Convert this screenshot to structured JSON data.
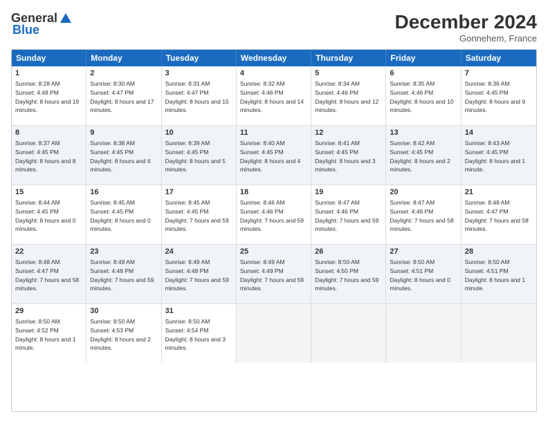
{
  "logo": {
    "general": "General",
    "blue": "Blue"
  },
  "header": {
    "month_year": "December 2024",
    "location": "Gonnehem, France"
  },
  "days_of_week": [
    "Sunday",
    "Monday",
    "Tuesday",
    "Wednesday",
    "Thursday",
    "Friday",
    "Saturday"
  ],
  "weeks": [
    [
      {
        "day": "1",
        "text": "Sunrise: 8:28 AM\nSunset: 4:48 PM\nDaylight: 8 hours and 19 minutes.",
        "shaded": false
      },
      {
        "day": "2",
        "text": "Sunrise: 8:30 AM\nSunset: 4:47 PM\nDaylight: 8 hours and 17 minutes.",
        "shaded": false
      },
      {
        "day": "3",
        "text": "Sunrise: 8:31 AM\nSunset: 4:47 PM\nDaylight: 8 hours and 15 minutes.",
        "shaded": false
      },
      {
        "day": "4",
        "text": "Sunrise: 8:32 AM\nSunset: 4:46 PM\nDaylight: 8 hours and 14 minutes.",
        "shaded": false
      },
      {
        "day": "5",
        "text": "Sunrise: 8:34 AM\nSunset: 4:46 PM\nDaylight: 8 hours and 12 minutes.",
        "shaded": false
      },
      {
        "day": "6",
        "text": "Sunrise: 8:35 AM\nSunset: 4:46 PM\nDaylight: 8 hours and 10 minutes.",
        "shaded": false
      },
      {
        "day": "7",
        "text": "Sunrise: 8:36 AM\nSunset: 4:45 PM\nDaylight: 8 hours and 9 minutes.",
        "shaded": false
      }
    ],
    [
      {
        "day": "8",
        "text": "Sunrise: 8:37 AM\nSunset: 4:45 PM\nDaylight: 8 hours and 8 minutes.",
        "shaded": true
      },
      {
        "day": "9",
        "text": "Sunrise: 8:38 AM\nSunset: 4:45 PM\nDaylight: 8 hours and 6 minutes.",
        "shaded": true
      },
      {
        "day": "10",
        "text": "Sunrise: 8:39 AM\nSunset: 4:45 PM\nDaylight: 8 hours and 5 minutes.",
        "shaded": true
      },
      {
        "day": "11",
        "text": "Sunrise: 8:40 AM\nSunset: 4:45 PM\nDaylight: 8 hours and 4 minutes.",
        "shaded": true
      },
      {
        "day": "12",
        "text": "Sunrise: 8:41 AM\nSunset: 4:45 PM\nDaylight: 8 hours and 3 minutes.",
        "shaded": true
      },
      {
        "day": "13",
        "text": "Sunrise: 8:42 AM\nSunset: 4:45 PM\nDaylight: 8 hours and 2 minutes.",
        "shaded": true
      },
      {
        "day": "14",
        "text": "Sunrise: 8:43 AM\nSunset: 4:45 PM\nDaylight: 8 hours and 1 minute.",
        "shaded": true
      }
    ],
    [
      {
        "day": "15",
        "text": "Sunrise: 8:44 AM\nSunset: 4:45 PM\nDaylight: 8 hours and 0 minutes.",
        "shaded": false
      },
      {
        "day": "16",
        "text": "Sunrise: 8:45 AM\nSunset: 4:45 PM\nDaylight: 8 hours and 0 minutes.",
        "shaded": false
      },
      {
        "day": "17",
        "text": "Sunrise: 8:45 AM\nSunset: 4:45 PM\nDaylight: 7 hours and 59 minutes.",
        "shaded": false
      },
      {
        "day": "18",
        "text": "Sunrise: 8:46 AM\nSunset: 4:46 PM\nDaylight: 7 hours and 59 minutes.",
        "shaded": false
      },
      {
        "day": "19",
        "text": "Sunrise: 8:47 AM\nSunset: 4:46 PM\nDaylight: 7 hours and 59 minutes.",
        "shaded": false
      },
      {
        "day": "20",
        "text": "Sunrise: 8:47 AM\nSunset: 4:46 PM\nDaylight: 7 hours and 58 minutes.",
        "shaded": false
      },
      {
        "day": "21",
        "text": "Sunrise: 8:48 AM\nSunset: 4:47 PM\nDaylight: 7 hours and 58 minutes.",
        "shaded": false
      }
    ],
    [
      {
        "day": "22",
        "text": "Sunrise: 8:48 AM\nSunset: 4:47 PM\nDaylight: 7 hours and 58 minutes.",
        "shaded": true
      },
      {
        "day": "23",
        "text": "Sunrise: 8:49 AM\nSunset: 4:48 PM\nDaylight: 7 hours and 59 minutes.",
        "shaded": true
      },
      {
        "day": "24",
        "text": "Sunrise: 8:49 AM\nSunset: 4:48 PM\nDaylight: 7 hours and 59 minutes.",
        "shaded": true
      },
      {
        "day": "25",
        "text": "Sunrise: 8:49 AM\nSunset: 4:49 PM\nDaylight: 7 hours and 59 minutes.",
        "shaded": true
      },
      {
        "day": "26",
        "text": "Sunrise: 8:50 AM\nSunset: 4:50 PM\nDaylight: 7 hours and 59 minutes.",
        "shaded": true
      },
      {
        "day": "27",
        "text": "Sunrise: 8:50 AM\nSunset: 4:51 PM\nDaylight: 8 hours and 0 minutes.",
        "shaded": true
      },
      {
        "day": "28",
        "text": "Sunrise: 8:50 AM\nSunset: 4:51 PM\nDaylight: 8 hours and 1 minute.",
        "shaded": true
      }
    ],
    [
      {
        "day": "29",
        "text": "Sunrise: 8:50 AM\nSunset: 4:52 PM\nDaylight: 8 hours and 1 minute.",
        "shaded": false
      },
      {
        "day": "30",
        "text": "Sunrise: 8:50 AM\nSunset: 4:53 PM\nDaylight: 8 hours and 2 minutes.",
        "shaded": false
      },
      {
        "day": "31",
        "text": "Sunrise: 8:50 AM\nSunset: 4:54 PM\nDaylight: 8 hours and 3 minutes.",
        "shaded": false
      },
      {
        "day": "",
        "text": "",
        "shaded": false,
        "empty": true
      },
      {
        "day": "",
        "text": "",
        "shaded": false,
        "empty": true
      },
      {
        "day": "",
        "text": "",
        "shaded": false,
        "empty": true
      },
      {
        "day": "",
        "text": "",
        "shaded": false,
        "empty": true
      }
    ]
  ]
}
